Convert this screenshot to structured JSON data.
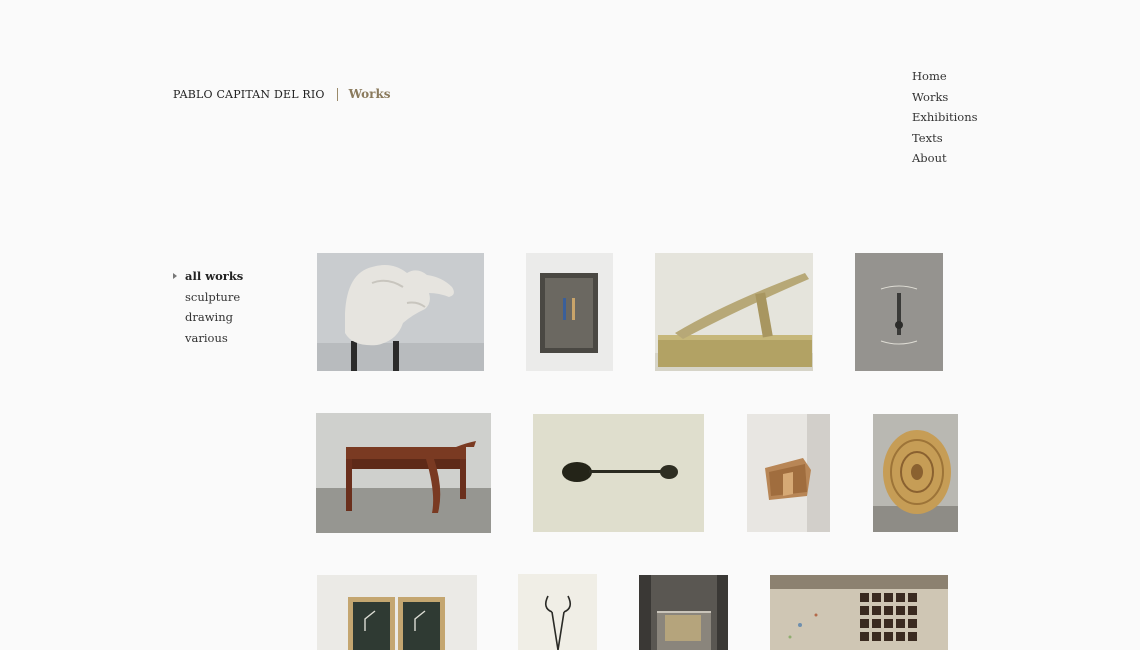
{
  "header": {
    "artist_name": "PABLO CAPITAN DEL RIO",
    "section_title": "Works"
  },
  "nav": {
    "items": [
      {
        "label": "Home"
      },
      {
        "label": "Works"
      },
      {
        "label": "Exhibitions"
      },
      {
        "label": "Texts"
      },
      {
        "label": "About"
      }
    ]
  },
  "filters": {
    "items": [
      {
        "label": "all works",
        "active": true
      },
      {
        "label": "sculpture",
        "active": false
      },
      {
        "label": "drawing",
        "active": false
      },
      {
        "label": "various",
        "active": false
      }
    ]
  },
  "gallery": {
    "items": [
      {
        "subject": "plaster-hand-sculpture"
      },
      {
        "subject": "boxed-pencils"
      },
      {
        "subject": "wooden-lever-sculpture"
      },
      {
        "subject": "wall-object-grey"
      },
      {
        "subject": "wooden-bench"
      },
      {
        "subject": "dark-spoon-object"
      },
      {
        "subject": "wall-wooden-block"
      },
      {
        "subject": "tree-ring-slab"
      },
      {
        "subject": "framed-drawings-pair"
      },
      {
        "subject": "wire-scissors-drawing"
      },
      {
        "subject": "vitrine-object"
      },
      {
        "subject": "installation-grid-portraits"
      }
    ]
  }
}
